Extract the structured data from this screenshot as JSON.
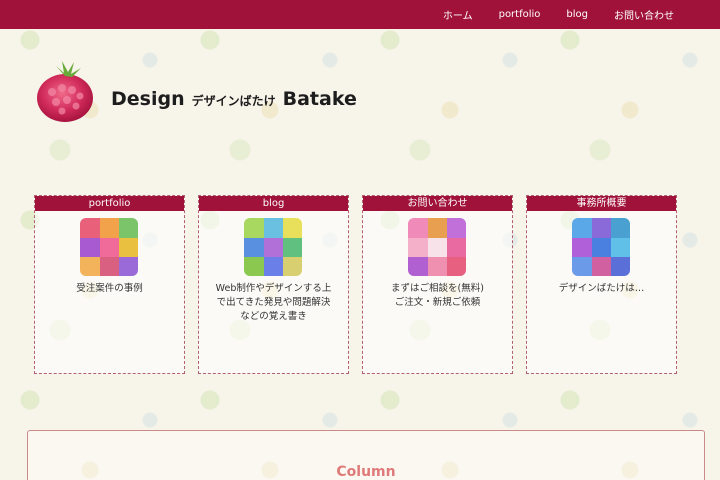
{
  "header": {
    "nav": [
      {
        "label": "ホーム"
      },
      {
        "label": "portfolio"
      },
      {
        "label": "blog"
      },
      {
        "label": "お問い合わせ"
      }
    ],
    "bar_color": "#a0123a"
  },
  "logo": {
    "icon": "raspberry-icon",
    "title_en_1": "Design",
    "title_ja": "デザインばたけ",
    "title_en_2": "Batake"
  },
  "cards": [
    {
      "title": "portfolio",
      "description": "受注案件の事例",
      "thumb_icon": "patchwork-warm-icon"
    },
    {
      "title": "blog",
      "description": "Web制作やデザインする上\nで出てきた発見や問題解決\nなどの覚え書き",
      "thumb_icon": "patchwork-green-icon"
    },
    {
      "title": "お問い合わせ",
      "description": "まずはご相談を(無料)\nご注文・新規ご依頼",
      "thumb_icon": "patchwork-pink-icon"
    },
    {
      "title": "事務所概要",
      "description": "デザインばたけは…",
      "thumb_icon": "patchwork-blue-icon"
    }
  ],
  "column": {
    "title": "Column"
  }
}
